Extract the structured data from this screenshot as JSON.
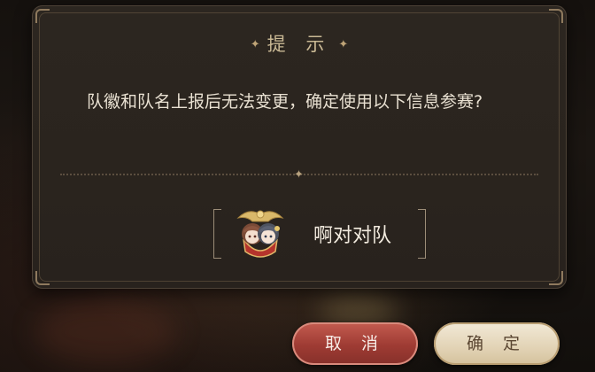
{
  "dialog": {
    "title": "提 示",
    "title_ornament": "✦",
    "message": "队徽和队名上报后无法变更，确定使用以下信息参赛?",
    "team": {
      "badge_icon": "team-badge-two-characters-icon",
      "name": "啊对对队"
    }
  },
  "buttons": {
    "cancel_label": "取 消",
    "confirm_label": "确 定"
  },
  "colors": {
    "dialog_bg": "#2a241e",
    "title_text": "#c9b894",
    "cancel_button": "#9e3b33",
    "confirm_button": "#e2d3b5"
  }
}
